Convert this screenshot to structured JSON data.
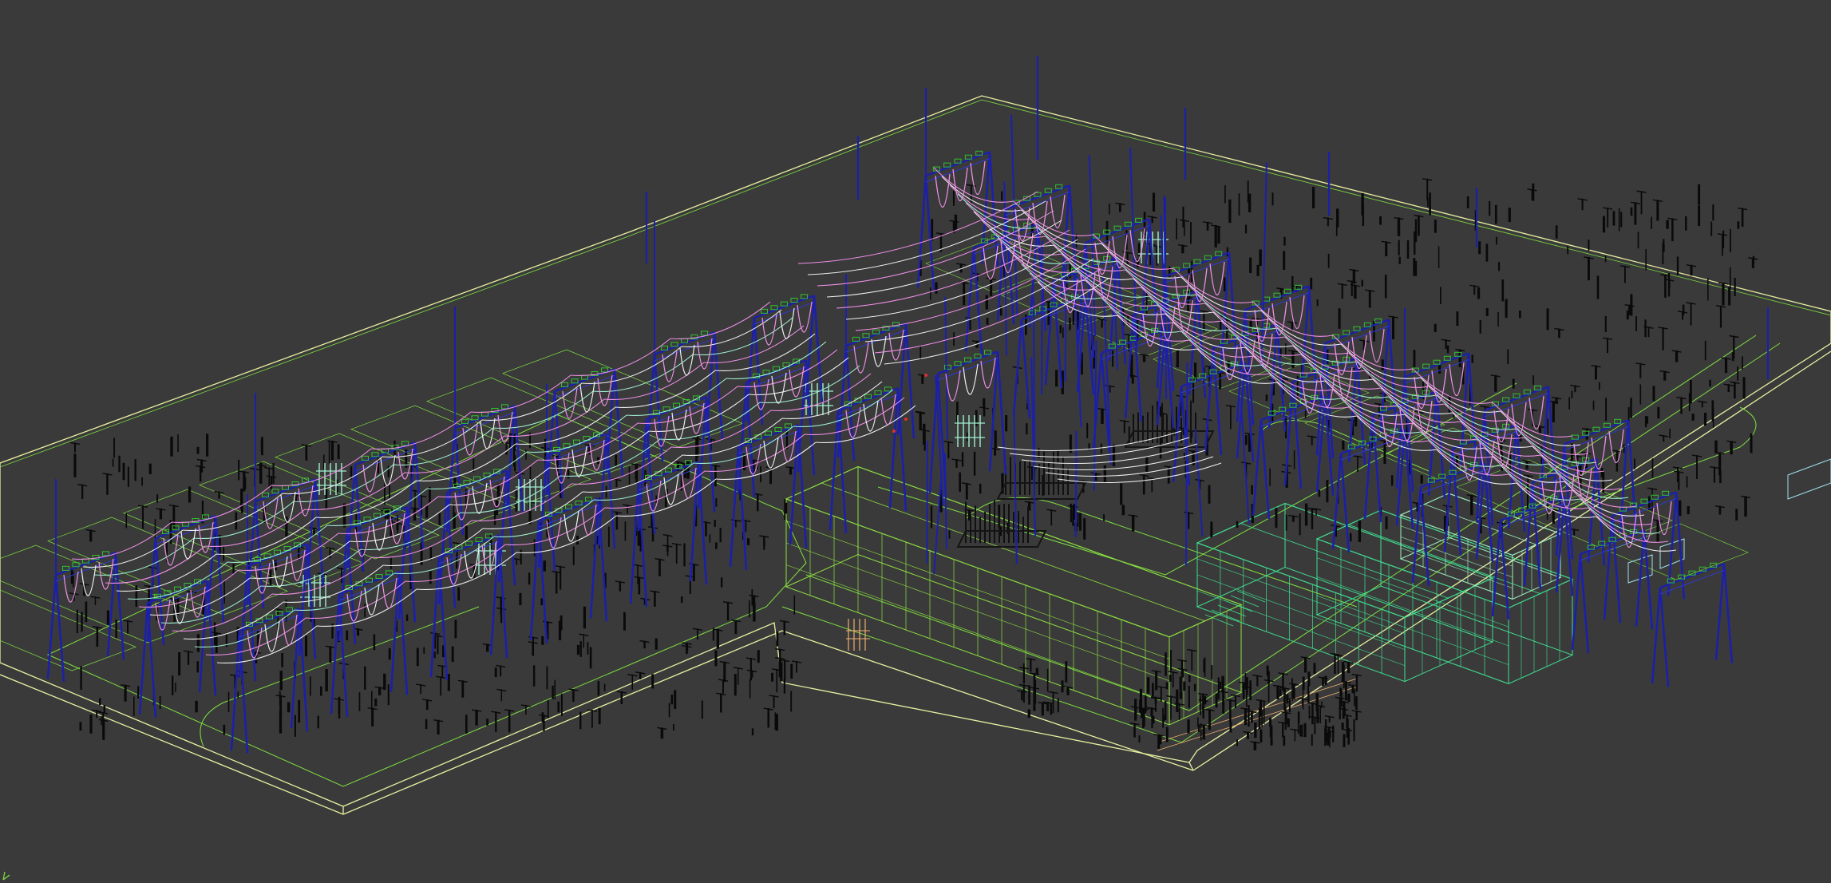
{
  "viewport": {
    "background": "#3a3a3a",
    "render_style": "wireframe",
    "subject": "substation-3d-model"
  },
  "palette": {
    "pad_outline": "#e8f0a0",
    "ground_lines": "#7fe040",
    "building_a": "#8ee040",
    "building_b": "#3fe090",
    "building_b_inner": "#a0f0c0",
    "tower_blue": "#1c20a8",
    "tower_blue_light": "#3038d0",
    "conductor_pink": "#f090e8",
    "conductor_white": "#f0f0f0",
    "conductor_mint": "#a0f0d0",
    "equipment_black": "#0a0a0a",
    "accent_orange": "#f0b070",
    "accent_cyan": "#a0e0f0",
    "accent_red": "#e03030",
    "insulator_green": "#30c030"
  },
  "icons": {
    "axis_tripod": "axis-tripod-icon"
  }
}
